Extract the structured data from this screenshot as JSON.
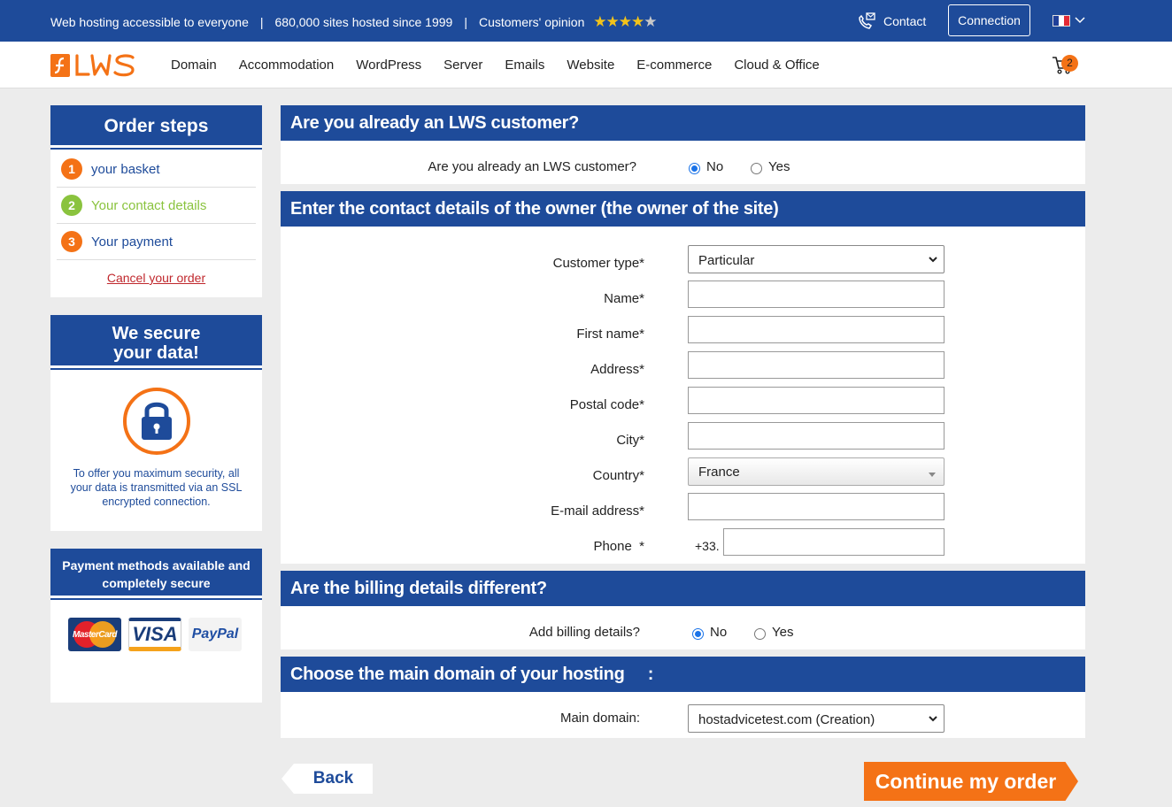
{
  "topbar": {
    "tagline": "Web hosting accessible to everyone",
    "sites": "680,000 sites hosted since 1999",
    "opinion": "Customers' opinion",
    "separator": "|",
    "stars_rating": 4.5,
    "contact": "Contact",
    "connection": "Connection",
    "language_flag": "france-flag"
  },
  "nav": {
    "items": [
      "Domain",
      "Accommodation",
      "WordPress",
      "Server",
      "Emails",
      "Website",
      "E-commerce",
      "Cloud & Office"
    ],
    "cart_count": "2"
  },
  "sidebar": {
    "steps_title": "Order steps",
    "steps": [
      {
        "num": "1",
        "label": "your basket",
        "color": "#f47216",
        "text_color": "#1e4b9a"
      },
      {
        "num": "2",
        "label": "Your contact details",
        "color": "#8ac33e",
        "text_color": "#8ac33e"
      },
      {
        "num": "3",
        "label": "Your payment",
        "color": "#f47216",
        "text_color": "#1e4b9a"
      }
    ],
    "cancel": "Cancel your order",
    "secure_title_1": "We secure",
    "secure_title_2": "your data!",
    "secure_text": "To offer you maximum security, all your data is transmitted via an SSL encrypted connection.",
    "payment_title_1": "Payment methods available and",
    "payment_title_2": "completely secure",
    "cards": [
      "MasterCard",
      "VISA",
      "PayPal"
    ]
  },
  "section1": {
    "title": "Are you already an LWS customer?",
    "question": "Are you already an LWS customer?",
    "no": "No",
    "yes": "Yes",
    "selected": "No"
  },
  "section2": {
    "title": "Enter the contact details of the owner (the owner of the site)",
    "labels": {
      "customer_type": "Customer type*",
      "name": "Name*",
      "first_name": "First name*",
      "address": "Address*",
      "postal_code": "Postal code*",
      "city": "City*",
      "country": "Country*",
      "email": "E-mail address*",
      "phone": "Phone  *"
    },
    "customer_type_value": "Particular",
    "country_value": "France",
    "phone_prefix": "+33."
  },
  "section3": {
    "title": "Are the billing details different?",
    "question": "Add billing details?",
    "no": "No",
    "yes": "Yes",
    "selected": "No"
  },
  "section4": {
    "title": "Choose the main domain of your hosting     :",
    "label": "Main domain:",
    "domain_value": "hostadvicetest.com (Creation)"
  },
  "buttons": {
    "back": "Back",
    "continue": "Continue my order"
  },
  "colors": {
    "brand_blue": "#1e4b9a",
    "accent_orange": "#f47216",
    "active_green": "#8ac33e"
  }
}
